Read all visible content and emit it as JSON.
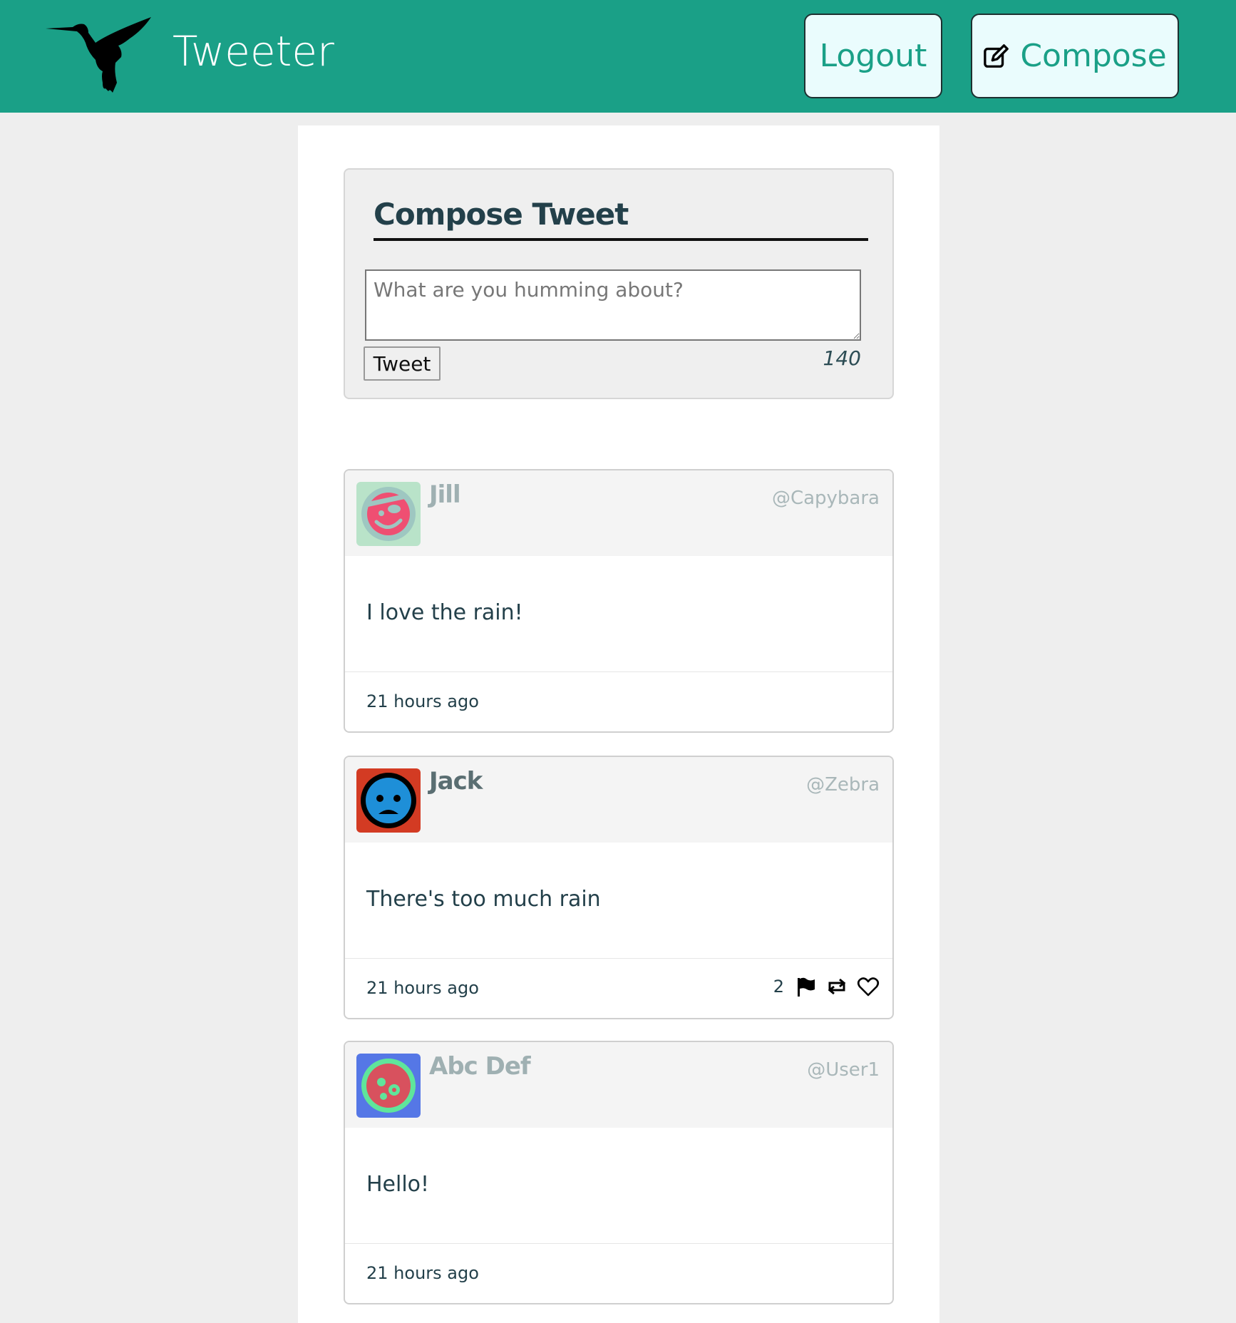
{
  "header": {
    "brand": "Tweeter",
    "logout_label": "Logout",
    "compose_label": "Compose",
    "bg_color": "#1aa087",
    "logo_icon": "hummingbird-icon",
    "compose_icon": "pencil-square-icon"
  },
  "compose": {
    "title": "Compose Tweet",
    "placeholder": "What are you humming about?",
    "value": "",
    "submit_label": "Tweet",
    "counter": "140"
  },
  "tweets": [
    {
      "name": "Jill",
      "name_color": "#9fb0b2",
      "handle": "@Capybara",
      "text": "I love the rain!",
      "time": "21 hours ago",
      "avatar_icon": "pirate-face-avatar"
    },
    {
      "name": "Jack",
      "name_color": "#5a6e72",
      "handle": "@Zebra",
      "text": "There's too much rain",
      "time": "21 hours ago",
      "avatar_icon": "sad-face-avatar",
      "action_count": "2",
      "action_icons": [
        "flag-icon",
        "retweet-icon",
        "heart-icon"
      ]
    },
    {
      "name": "Abc Def",
      "name_color": "#9fb0b2",
      "handle": "@User1",
      "text": "Hello!",
      "time": "21 hours ago",
      "avatar_icon": "dizzy-face-avatar"
    }
  ]
}
